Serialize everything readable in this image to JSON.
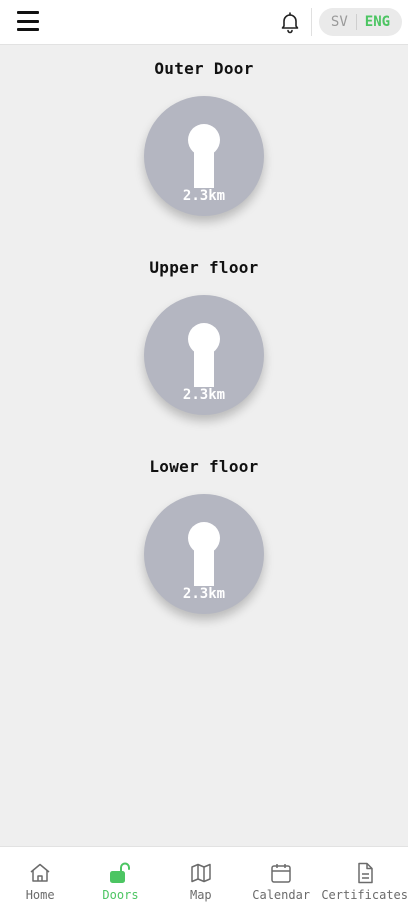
{
  "header": {
    "menu_icon": "hamburger-menu-icon",
    "bell_icon": "bell-icon",
    "lang_sv": "SV",
    "lang_eng": "ENG",
    "active_language": "ENG",
    "accent_color": "#4cc562"
  },
  "doors": [
    {
      "title": "Outer Door",
      "distance": "2.3km",
      "icon": "keyhole-icon"
    },
    {
      "title": "Upper floor",
      "distance": "2.3km",
      "icon": "keyhole-icon"
    },
    {
      "title": "Lower floor",
      "distance": "2.3km",
      "icon": "keyhole-icon"
    }
  ],
  "nav": {
    "active": "Doors",
    "items": [
      {
        "label": "Home",
        "icon": "home-icon"
      },
      {
        "label": "Doors",
        "icon": "unlocked-padlock-icon"
      },
      {
        "label": "Map",
        "icon": "map-icon"
      },
      {
        "label": "Calendar",
        "icon": "calendar-icon"
      },
      {
        "label": "Certificates",
        "icon": "document-icon"
      }
    ]
  },
  "colors": {
    "door_button": "#b4b6c1",
    "background": "#efefef",
    "active_nav": "#4cc562",
    "inactive_nav": "#6b6b6b"
  }
}
